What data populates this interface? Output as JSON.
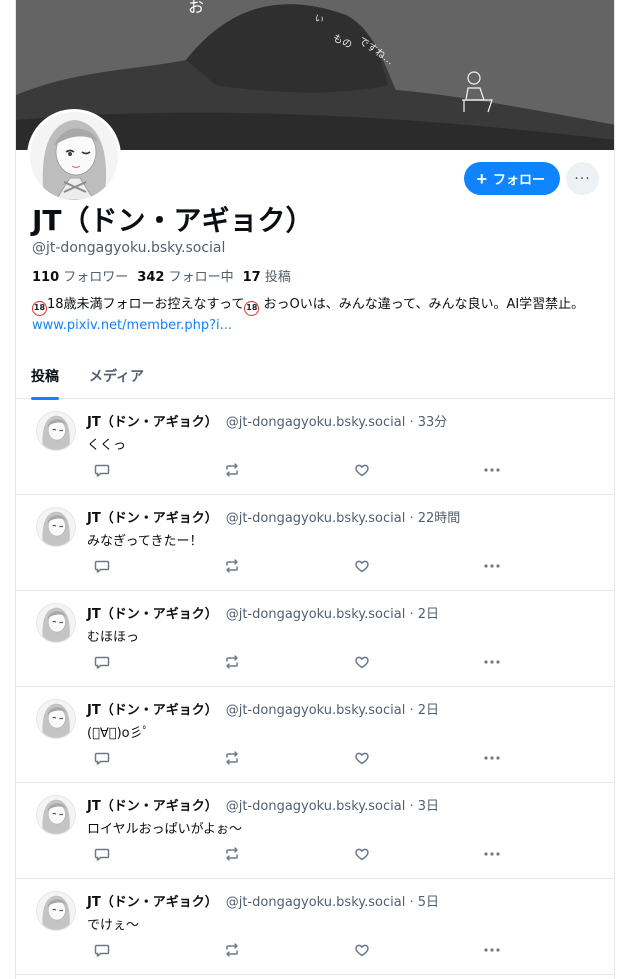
{
  "banner": {
    "art_text": [
      "お",
      "い",
      "もの",
      "ですね…"
    ]
  },
  "profile": {
    "display_name": "JT（ドン・アギョク）",
    "handle": "@jt-dongagyoku.bsky.social",
    "followers_count": "110",
    "followers_label": "フォロワー",
    "following_count": "342",
    "following_label": "フォロー中",
    "posts_count": "17",
    "posts_label": "投稿",
    "bio_badge": "18",
    "bio_part1": "18歳未満フォローお控えなすって",
    "bio_part2": " おっOいは、みんな違って、みんな良い。AI学習禁止。",
    "website": "www.pixiv.net/member.php?i..."
  },
  "actions": {
    "follow_label": "フォロー",
    "more_label": "···"
  },
  "tabs": [
    {
      "label": "投稿",
      "active": true
    },
    {
      "label": "メディア",
      "active": false
    }
  ],
  "posts": [
    {
      "author": "JT（ドン・アギョク）",
      "meta": "@jt-dongagyoku.bsky.social · 33分",
      "text": "くくっ"
    },
    {
      "author": "JT（ドン・アギョク）",
      "meta": "@jt-dongagyoku.bsky.social · 22時間",
      "text": "みなぎってきたー！"
    },
    {
      "author": "JT（ドン・アギョク）",
      "meta": "@jt-dongagyoku.bsky.social · 2日",
      "text": "むほほっ"
    },
    {
      "author": "JT（ドン・アギョク）",
      "meta": "@jt-dongagyoku.bsky.social · 2日",
      "text": "(ﾟ∀ﾟ)o彡ﾟ"
    },
    {
      "author": "JT（ドン・アギョク）",
      "meta": "@jt-dongagyoku.bsky.social · 3日",
      "text": "ロイヤルおっぱいがよぉ〜"
    },
    {
      "author": "JT（ドン・アギョク）",
      "meta": "@jt-dongagyoku.bsky.social · 5日",
      "text": "でけぇ〜"
    }
  ],
  "icons": {
    "reply": "reply-icon",
    "repost": "repost-icon",
    "like": "like-icon",
    "more": "more-icon"
  },
  "colors": {
    "accent": "#1083fe",
    "secondary_text": "#52606e",
    "border": "#e3e8ee",
    "icon": "#6b7a89"
  }
}
